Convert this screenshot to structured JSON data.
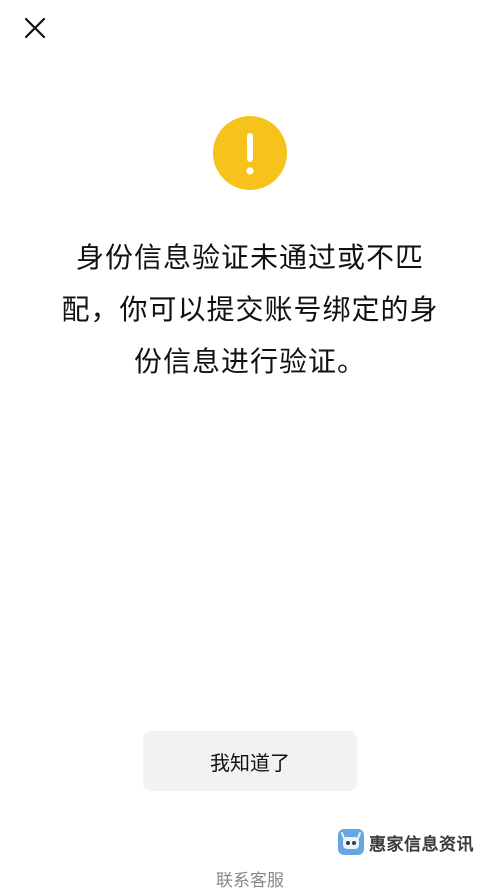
{
  "header": {
    "close_icon": "close-icon"
  },
  "alert": {
    "icon": "exclamation-warning-icon",
    "icon_color": "#f8c21c",
    "message_lines": [
      "身份信息验证未通过或不匹",
      "配，你可以提交账号绑定的身",
      "份信息进行验证。"
    ]
  },
  "actions": {
    "confirm_label": "我知道了"
  },
  "watermark": {
    "text": "惠家信息资讯"
  },
  "footer": {
    "support_label": "联系客服"
  }
}
